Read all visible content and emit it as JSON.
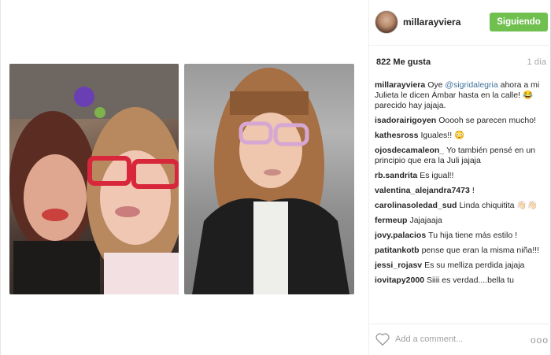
{
  "post": {
    "username": "millarayviera",
    "follow_label": "Siguiendo",
    "likes": "822 Me gusta",
    "time": "1 día",
    "caption": {
      "user": "millarayviera",
      "before": "Oye ",
      "mention": "@sigridalegria",
      "after": " ahora a mi Julieta le dicen Ámbar hasta en la calle! 😂 parecido hay jajaja."
    },
    "comments": [
      {
        "user": "isadorairigoyen",
        "text": "Ooooh se parecen mucho!"
      },
      {
        "user": "kathesross",
        "text": "Iguales!! 😳"
      },
      {
        "user": "ojosdecamaleon_",
        "text": "Yo también pensé en un principio que era la Juli jajaja"
      },
      {
        "user": "rb.sandrita",
        "text": "Es igual!!"
      },
      {
        "user": "valentina_alejandra7473",
        "text": "!"
      },
      {
        "user": "carolinasoledad_sud",
        "text": "Linda chiquitita 👋🏻👋🏻"
      },
      {
        "user": "fermeup",
        "text": "Jajajaaja"
      },
      {
        "user": "jovy.palacios",
        "text": "Tu hija tiene más estilo !"
      },
      {
        "user": "patitankotb",
        "text": "pense que eran la misma niña!!!"
      },
      {
        "user": "jessi_rojasv",
        "text": "Es su melliza perdida jajaja"
      },
      {
        "user": "iovitapy2000",
        "text": "Siiii es verdad....bella tu"
      }
    ],
    "add_comment_placeholder": "Add a comment...",
    "more_label": "ooo"
  },
  "icons": {
    "heart": "heart-icon",
    "more": "more-options-icon"
  },
  "colors": {
    "follow_button": "#70c050",
    "mention": "#3f729b",
    "muted": "#a5a7aa"
  }
}
